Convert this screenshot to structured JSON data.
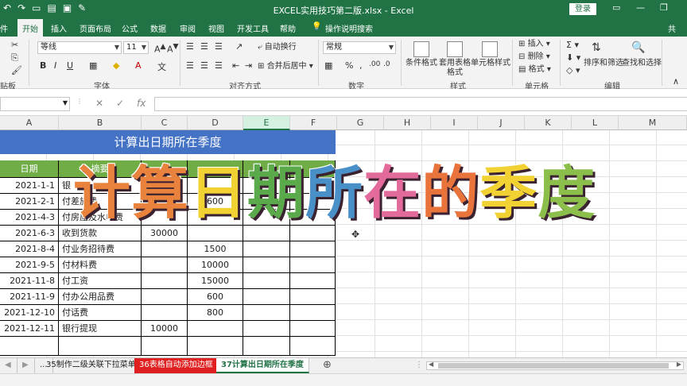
{
  "titlebar": {
    "title": "EXCEL实用技巧第二版.xlsx  -  Excel",
    "login": "登录"
  },
  "tabs": [
    "开始",
    "插入",
    "页面布局",
    "公式",
    "数据",
    "审阅",
    "视图",
    "开发工具",
    "帮助",
    "操作说明搜索"
  ],
  "ribbon": {
    "font_name": "等线",
    "font_size": "11",
    "wrap": "自动换行",
    "merge": "合并后居中",
    "number_format": "常规",
    "cond_format": "条件格式",
    "table_format": "套用表格格式",
    "cell_style": "单元格样式",
    "insert": "插入",
    "delete": "删除",
    "format": "格式",
    "sort": "排序和筛选",
    "find": "查找和选择",
    "groups": {
      "clipboard": "贴板",
      "font": "字体",
      "align": "对齐方式",
      "number": "数字",
      "styles": "样式",
      "cells": "单元格",
      "edit": "编辑"
    }
  },
  "columns": [
    "A",
    "B",
    "C",
    "D",
    "E",
    "F",
    "G",
    "H",
    "I",
    "J",
    "K",
    "L",
    "M"
  ],
  "sheet": {
    "title": "计算出日期所在季度",
    "headers": [
      "日期",
      "摘要",
      "",
      "",
      "",
      ""
    ],
    "rows": [
      [
        "2021-1-1",
        "银",
        "",
        "",
        "",
        ""
      ],
      [
        "2021-2-1",
        "付差旅费",
        "",
        "600",
        "",
        ""
      ],
      [
        "2021-4-3",
        "付房屋及水电费",
        "",
        "",
        "",
        ""
      ],
      [
        "2021-6-3",
        "收到货款",
        "30000",
        "",
        "",
        ""
      ],
      [
        "2021-8-4",
        "付业务招待费",
        "",
        "1500",
        "",
        ""
      ],
      [
        "2021-9-5",
        "付材料费",
        "",
        "10000",
        "",
        ""
      ],
      [
        "2021-11-8",
        "付工资",
        "",
        "15000",
        "",
        ""
      ],
      [
        "2021-11-9",
        "付办公用品费",
        "",
        "600",
        "",
        ""
      ],
      [
        "2021-12-10",
        "付话费",
        "",
        "800",
        "",
        ""
      ],
      [
        "2021-12-11",
        "银行提现",
        "10000",
        "",
        "",
        ""
      ]
    ]
  },
  "overlay": {
    "chars": [
      "计",
      "算",
      "日",
      "期",
      "所",
      "在",
      "的",
      "季",
      "度"
    ],
    "colors": [
      "#e8823c",
      "#e8823c",
      "#f2d233",
      "#5aa94a",
      "#4a90c8",
      "#e36b9b",
      "#e8743c",
      "#f2d233",
      "#8bbe4a"
    ]
  },
  "sheettabs": {
    "ellipsis": "...",
    "t1": "35制作二级关联下拉菜单",
    "t2": "36表格自动添加边框",
    "t3": "37计算出日期所在季度"
  }
}
